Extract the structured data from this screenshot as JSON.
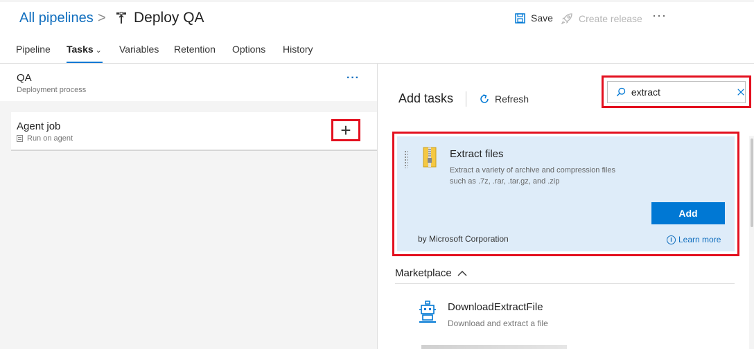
{
  "header": {
    "breadcrumb_root": "All pipelines",
    "breadcrumb_sep": ">",
    "pipeline_title": "Deploy QA",
    "save_label": "Save",
    "create_release_label": "Create release",
    "more_label": "···"
  },
  "tabs": [
    {
      "label": "Pipeline"
    },
    {
      "label": "Tasks",
      "active": true
    },
    {
      "label": "Variables"
    },
    {
      "label": "Retention"
    },
    {
      "label": "Options"
    },
    {
      "label": "History"
    }
  ],
  "left_panel": {
    "stage_name": "QA",
    "stage_sub": "Deployment process",
    "stage_more": "···",
    "job_name": "Agent job",
    "job_sub": "Run on agent",
    "add_task_symbol": "+"
  },
  "add_tasks": {
    "title": "Add tasks",
    "refresh_label": "Refresh",
    "search_value": "extract",
    "task": {
      "name": "Extract files",
      "description": "Extract a variety of archive and compression files such as .7z, .rar, .tar.gz, and .zip",
      "add_label": "Add",
      "author": "by Microsoft Corporation",
      "learn_more": "Learn more"
    },
    "marketplace_label": "Marketplace",
    "marketplace_items": [
      {
        "name": "DownloadExtractFile",
        "description": "Download and extract a file"
      }
    ]
  },
  "colors": {
    "accent": "#0078d4",
    "link": "#106ebe",
    "highlight": "#e3101f",
    "task_card_bg": "#deecf9"
  }
}
